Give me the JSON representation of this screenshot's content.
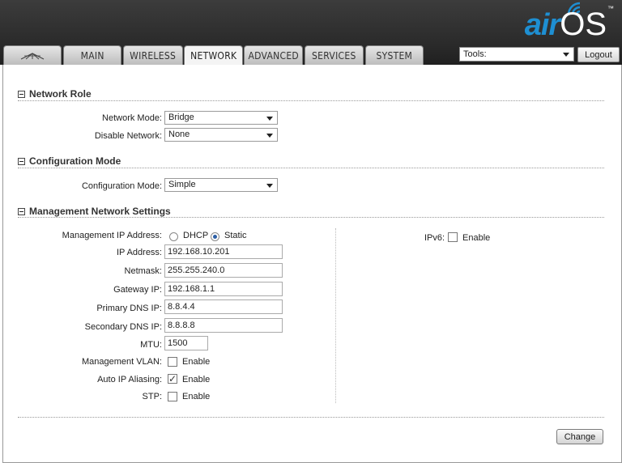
{
  "brand": {
    "air": "air",
    "os": "OS",
    "tm": "™"
  },
  "tabs": [
    {
      "label": ""
    },
    {
      "label": "MAIN"
    },
    {
      "label": "WIRELESS"
    },
    {
      "label": "NETWORK"
    },
    {
      "label": "ADVANCED"
    },
    {
      "label": "SERVICES"
    },
    {
      "label": "SYSTEM"
    }
  ],
  "active_tab": "NETWORK",
  "tools": {
    "selected": "Tools:"
  },
  "logout_label": "Logout",
  "network_role": {
    "title": "Network Role",
    "network_mode_label": "Network Mode:",
    "network_mode_value": "Bridge",
    "disable_network_label": "Disable Network:",
    "disable_network_value": "None"
  },
  "configuration_mode": {
    "title": "Configuration Mode",
    "label": "Configuration Mode:",
    "value": "Simple"
  },
  "management": {
    "title": "Management Network Settings",
    "ip_mode_label": "Management IP Address:",
    "dhcp_label": "DHCP",
    "static_label": "Static",
    "ip_mode_selected": "Static",
    "ip_address_label": "IP Address:",
    "ip_address": "192.168.10.201",
    "netmask_label": "Netmask:",
    "netmask": "255.255.240.0",
    "gateway_label": "Gateway IP:",
    "gateway": "192.168.1.1",
    "primary_dns_label": "Primary DNS IP:",
    "primary_dns": "8.8.4.4",
    "secondary_dns_label": "Secondary DNS IP:",
    "secondary_dns": "8.8.8.8",
    "mtu_label": "MTU:",
    "mtu": "1500",
    "vlan_label": "Management VLAN:",
    "vlan_enable": "Enable",
    "vlan_checked": false,
    "aliasing_label": "Auto IP Aliasing:",
    "aliasing_enable": "Enable",
    "aliasing_checked": true,
    "stp_label": "STP:",
    "stp_enable": "Enable",
    "stp_checked": false,
    "ipv6_label": "IPv6:",
    "ipv6_enable": "Enable",
    "ipv6_checked": false
  },
  "change_label": "Change",
  "check_mark": "✓"
}
